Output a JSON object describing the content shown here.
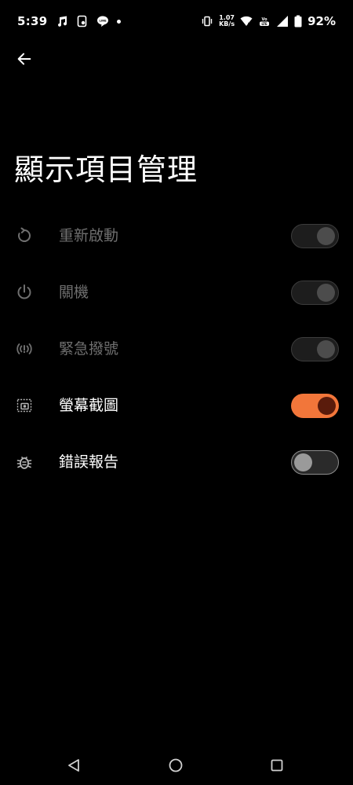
{
  "status_bar": {
    "time": "5:39",
    "net_speed_value": "1.07",
    "net_speed_unit": "KB/s",
    "battery_percent": "92%",
    "left_icons": [
      "music-note-icon",
      "notification-app-icon",
      "line-app-icon",
      "dot-icon"
    ],
    "right_icons": [
      "vibrate-icon",
      "wifi-icon",
      "volte-icon",
      "signal-icon",
      "battery-icon"
    ]
  },
  "header": {
    "back_icon": "arrow-left-icon",
    "title": "顯示項目管理"
  },
  "items": [
    {
      "label": "重新啟動",
      "icon": "restart-icon",
      "enabled": false,
      "toggle": "on"
    },
    {
      "label": "關機",
      "icon": "power-icon",
      "enabled": false,
      "toggle": "on"
    },
    {
      "label": "緊急撥號",
      "icon": "emergency-call-icon",
      "enabled": false,
      "toggle": "on"
    },
    {
      "label": "螢幕截圖",
      "icon": "screenshot-icon",
      "enabled": true,
      "toggle": "on"
    },
    {
      "label": "錯誤報告",
      "icon": "bug-report-icon",
      "enabled": true,
      "toggle": "off"
    }
  ],
  "colors": {
    "background": "#000000",
    "accent": "#f2763a",
    "disabled_text": "#6f6f6f"
  },
  "nav_bar": {
    "icons": [
      "nav-back-icon",
      "nav-home-icon",
      "nav-recents-icon"
    ]
  }
}
